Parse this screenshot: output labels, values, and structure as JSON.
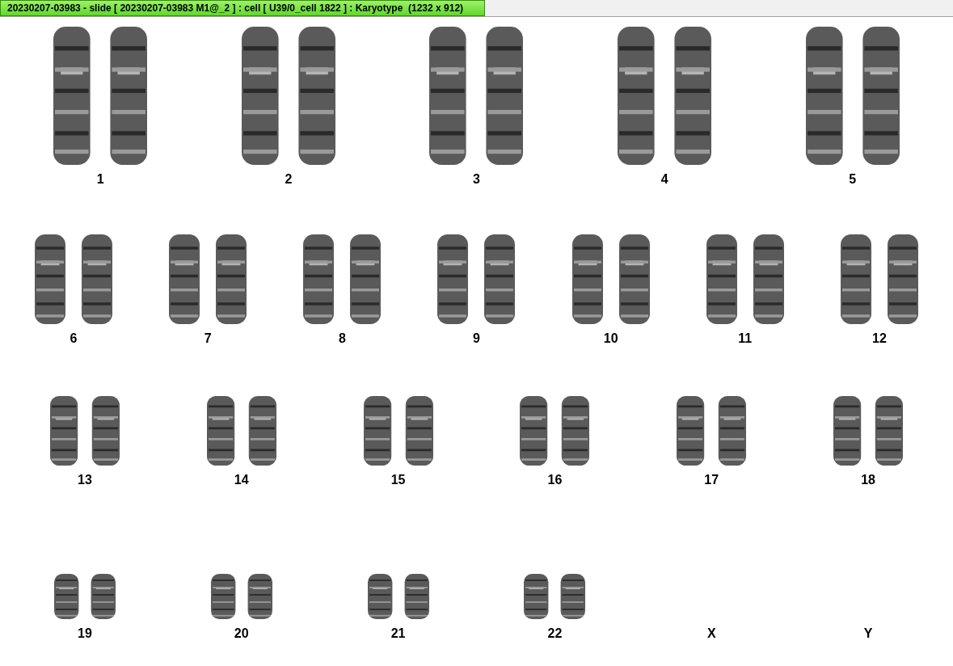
{
  "window": {
    "title": "20230207-03983 - slide [ 20230207-03983 M1@_2 ] : cell [ U39/0_cell 1822 ] : Karyotype  (1232 x 912)"
  },
  "rows": [
    {
      "chromosomes": [
        {
          "label": "1",
          "shown": true
        },
        {
          "label": "2",
          "shown": true
        },
        {
          "label": "3",
          "shown": true
        },
        {
          "label": "4",
          "shown": true
        },
        {
          "label": "5",
          "shown": true
        }
      ]
    },
    {
      "chromosomes": [
        {
          "label": "6",
          "shown": true
        },
        {
          "label": "7",
          "shown": true
        },
        {
          "label": "8",
          "shown": true
        },
        {
          "label": "9",
          "shown": true
        },
        {
          "label": "10",
          "shown": true
        },
        {
          "label": "11",
          "shown": true
        },
        {
          "label": "12",
          "shown": true
        }
      ]
    },
    {
      "chromosomes": [
        {
          "label": "13",
          "shown": true
        },
        {
          "label": "14",
          "shown": true
        },
        {
          "label": "15",
          "shown": true
        },
        {
          "label": "16",
          "shown": true
        },
        {
          "label": "17",
          "shown": true
        },
        {
          "label": "18",
          "shown": true
        }
      ]
    },
    {
      "chromosomes": [
        {
          "label": "19",
          "shown": true
        },
        {
          "label": "20",
          "shown": true
        },
        {
          "label": "21",
          "shown": true
        },
        {
          "label": "22",
          "shown": true
        },
        {
          "label": "X",
          "shown": false
        },
        {
          "label": "Y",
          "shown": false
        }
      ]
    }
  ]
}
